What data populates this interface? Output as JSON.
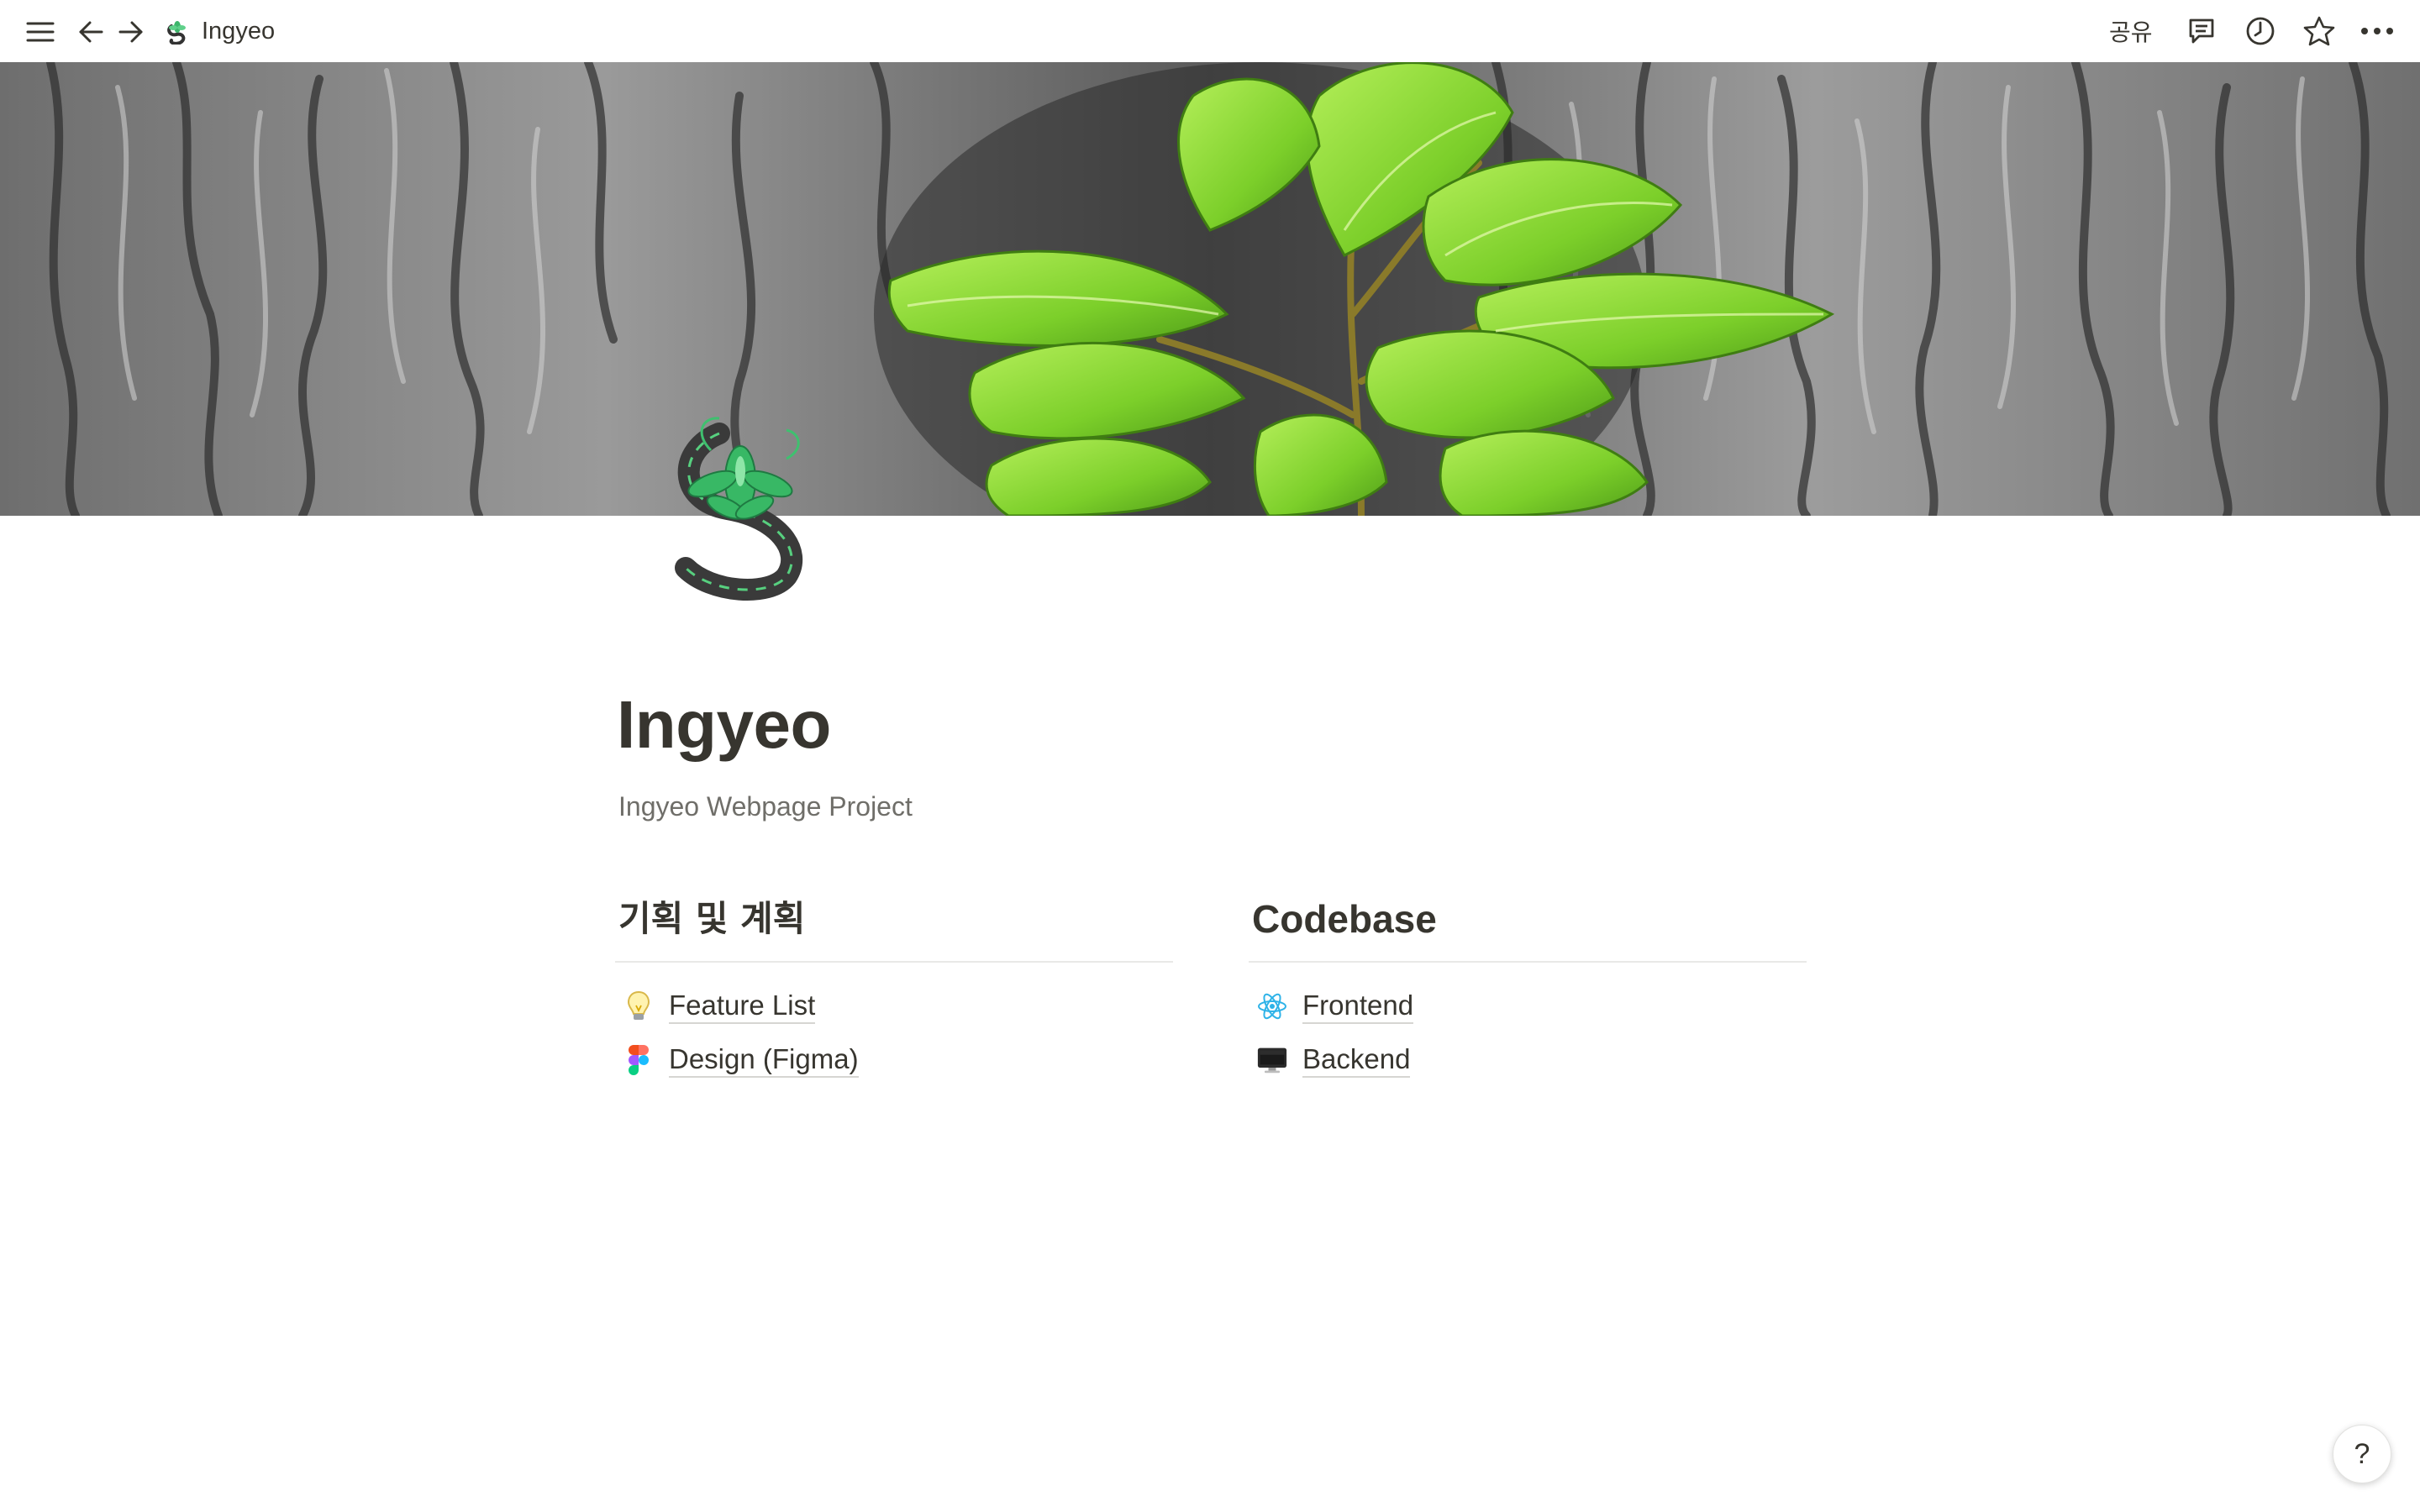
{
  "topbar": {
    "icons": [
      "menu-icon",
      "back-arrow-icon",
      "forward-arrow-icon"
    ],
    "breadcrumb_title": "Ingyeo",
    "share_label": "공유",
    "right_icons": [
      "comments-icon",
      "history-icon",
      "favorite-star-icon",
      "more-icon"
    ]
  },
  "page": {
    "title": "Ingyeo",
    "subtitle": "Ingyeo Webpage Project"
  },
  "columns": [
    {
      "heading": "기획 및 계획",
      "links": [
        {
          "icon": "lightbulb-icon",
          "label": "Feature List"
        },
        {
          "icon": "figma-icon",
          "label": "Design (Figma)"
        }
      ]
    },
    {
      "heading": "Codebase",
      "links": [
        {
          "icon": "react-icon",
          "label": "Frontend"
        },
        {
          "icon": "desktop-computer-icon",
          "label": "Backend"
        }
      ]
    }
  ],
  "help": {
    "label": "?"
  },
  "colors": {
    "text": "#37352f",
    "muted": "#6f6e69",
    "divider": "#e9e9e7",
    "leaf_green": "#7ccf2a",
    "react_blue": "#2fb3e8"
  }
}
